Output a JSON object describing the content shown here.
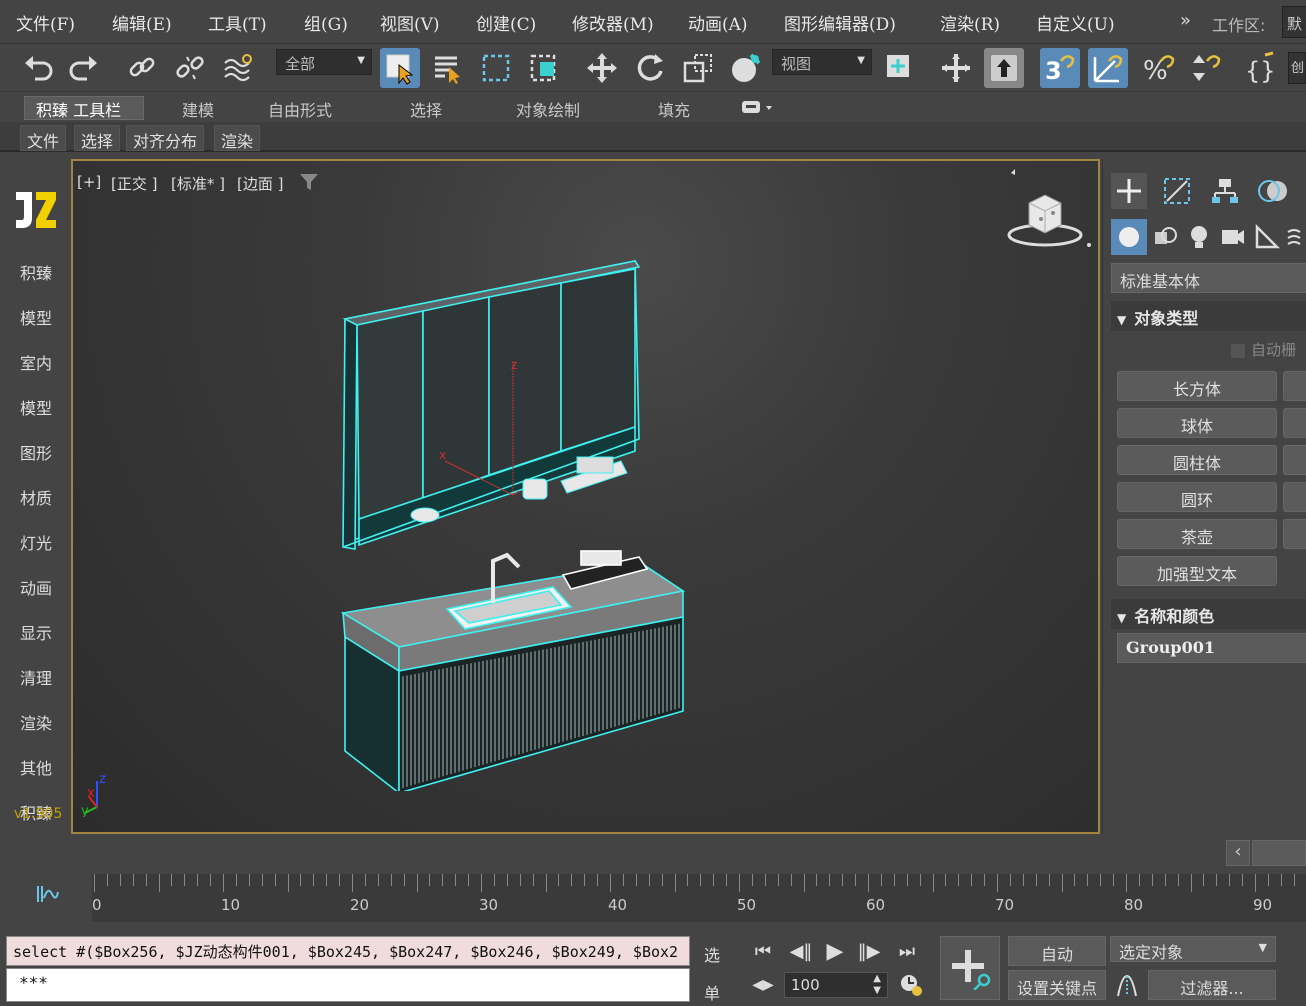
{
  "menubar": {
    "items": [
      "文件(F)",
      "编辑(E)",
      "工具(T)",
      "组(G)",
      "视图(V)",
      "创建(C)",
      "修改器(M)",
      "动画(A)",
      "图形编辑器(D)",
      "渲染(R)",
      "自定义(U)"
    ],
    "workspace_label": "工作区:",
    "workspace_value": "默"
  },
  "toolbar": {
    "selection_filter": "全部",
    "ref_coord": "视图",
    "right_trunc": "创"
  },
  "ribbon": {
    "tabs": [
      "积臻 工具栏",
      "建模",
      "自由形式",
      "选择",
      "对象绘制",
      "填充"
    ],
    "subtabs": [
      "文件",
      "选择",
      "对齐分布",
      "渲染"
    ]
  },
  "leftbar": {
    "items": [
      "积臻",
      "模型",
      "室内",
      "模型",
      "图形",
      "材质",
      "灯光",
      "动画",
      "显示",
      "清理",
      "渲染",
      "其他",
      "积臻"
    ],
    "version": "v1.905"
  },
  "viewport": {
    "label_plus": "[+]",
    "label_view": "[正交 ]",
    "label_shading": "[标准* ]",
    "label_edge": "[边面 ]",
    "axis_x": "x",
    "axis_y": "y",
    "axis_z": "z"
  },
  "command_panel": {
    "category": "标准基本体",
    "section_object_type": "对象类型",
    "autogrid": "自动栅",
    "buttons": [
      "长方体",
      "球体",
      "圆柱体",
      "圆环",
      "茶壶",
      "加强型文本"
    ],
    "section_name_color": "名称和颜色",
    "object_name": "Group001"
  },
  "timeline": {
    "ticks": [
      "0",
      "10",
      "20",
      "30",
      "40",
      "50",
      "60",
      "70",
      "80",
      "90"
    ]
  },
  "status": {
    "script_line": "select #($Box256, $JZ动态构件001, $Box245, $Box247, $Box246, $Box249, $Box2",
    "script_input": "***",
    "sel_label_1": "选",
    "sel_label_2": "单",
    "frame_value": "100",
    "auto_key": "自动",
    "set_key": "设置关键点",
    "selected_object": "选定对象",
    "filters": "过滤器..."
  },
  "colors": {
    "accent": "#5a8ab8",
    "viewport_border": "#a08440",
    "selection": "#3ff0f0"
  }
}
